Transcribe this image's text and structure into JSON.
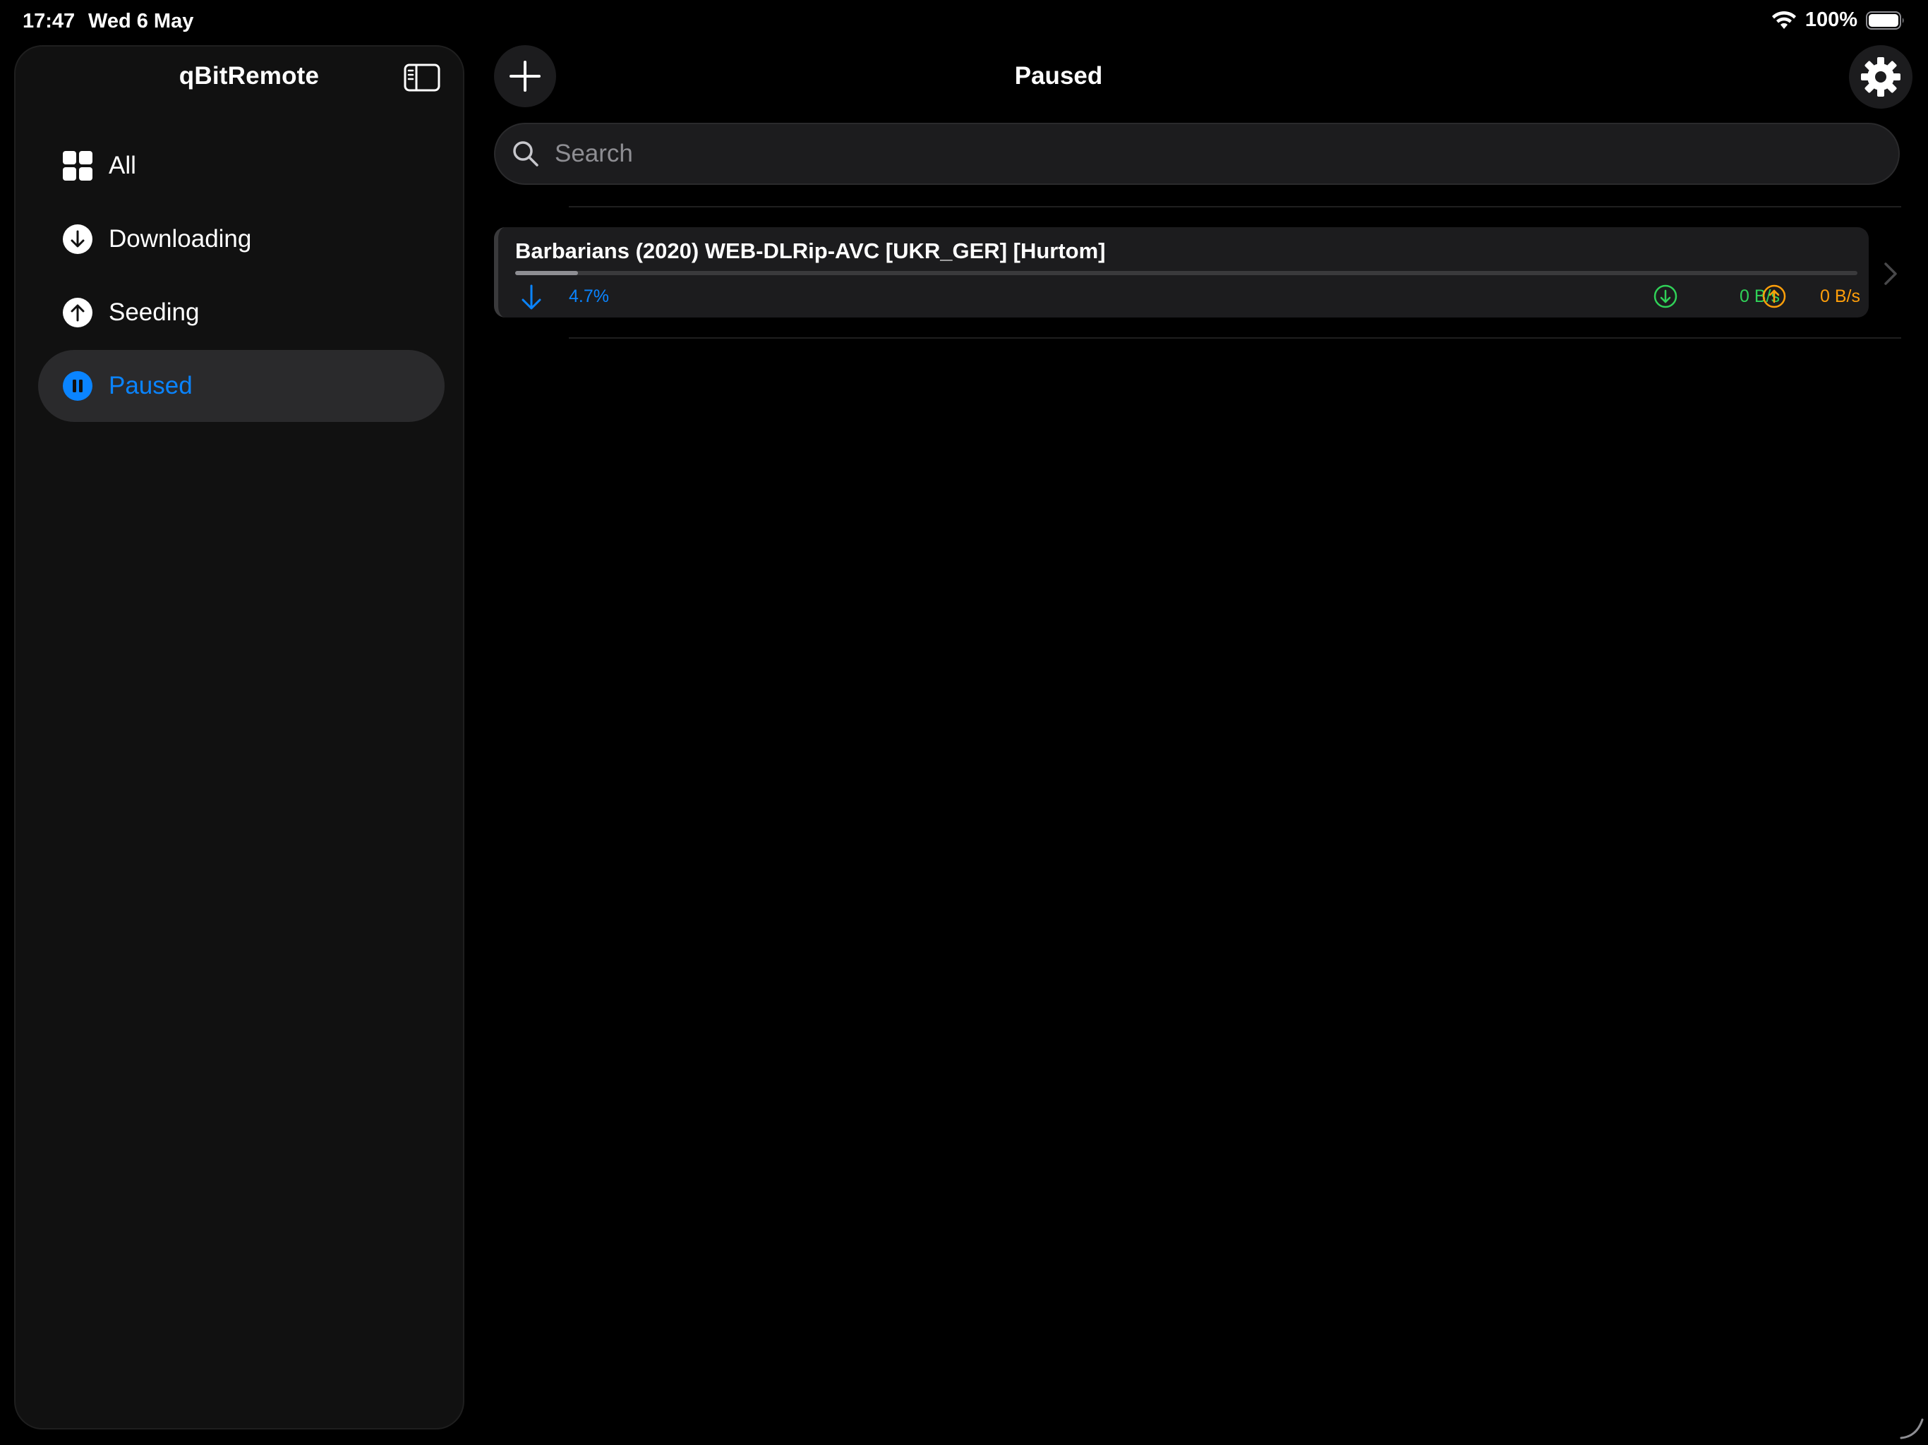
{
  "status_bar": {
    "time": "17:47",
    "date": "Wed 6 May",
    "battery": "100%"
  },
  "sidebar": {
    "title": "qBitRemote",
    "items": [
      {
        "label": "All",
        "icon": "grid-icon",
        "active": false
      },
      {
        "label": "Downloading",
        "icon": "arrow-down-circle-icon",
        "active": false
      },
      {
        "label": "Seeding",
        "icon": "arrow-up-circle-icon",
        "active": false
      },
      {
        "label": "Paused",
        "icon": "pause-circle-icon",
        "active": true
      }
    ]
  },
  "main": {
    "title": "Paused",
    "search": {
      "placeholder": "Search",
      "value": ""
    },
    "torrents": [
      {
        "name": "Barbarians (2020) WEB-DLRip-AVC [UKR_GER] [Hurtom]",
        "progress_percent": "4.7%",
        "progress_fraction": 0.047,
        "download_speed": "0 B/s",
        "upload_speed": "0 B/s"
      }
    ]
  },
  "colors": {
    "accent": "#0a84ff",
    "download": "#30d158",
    "upload": "#ff9f0a",
    "background": "#000000",
    "sidebar": "#111111"
  }
}
